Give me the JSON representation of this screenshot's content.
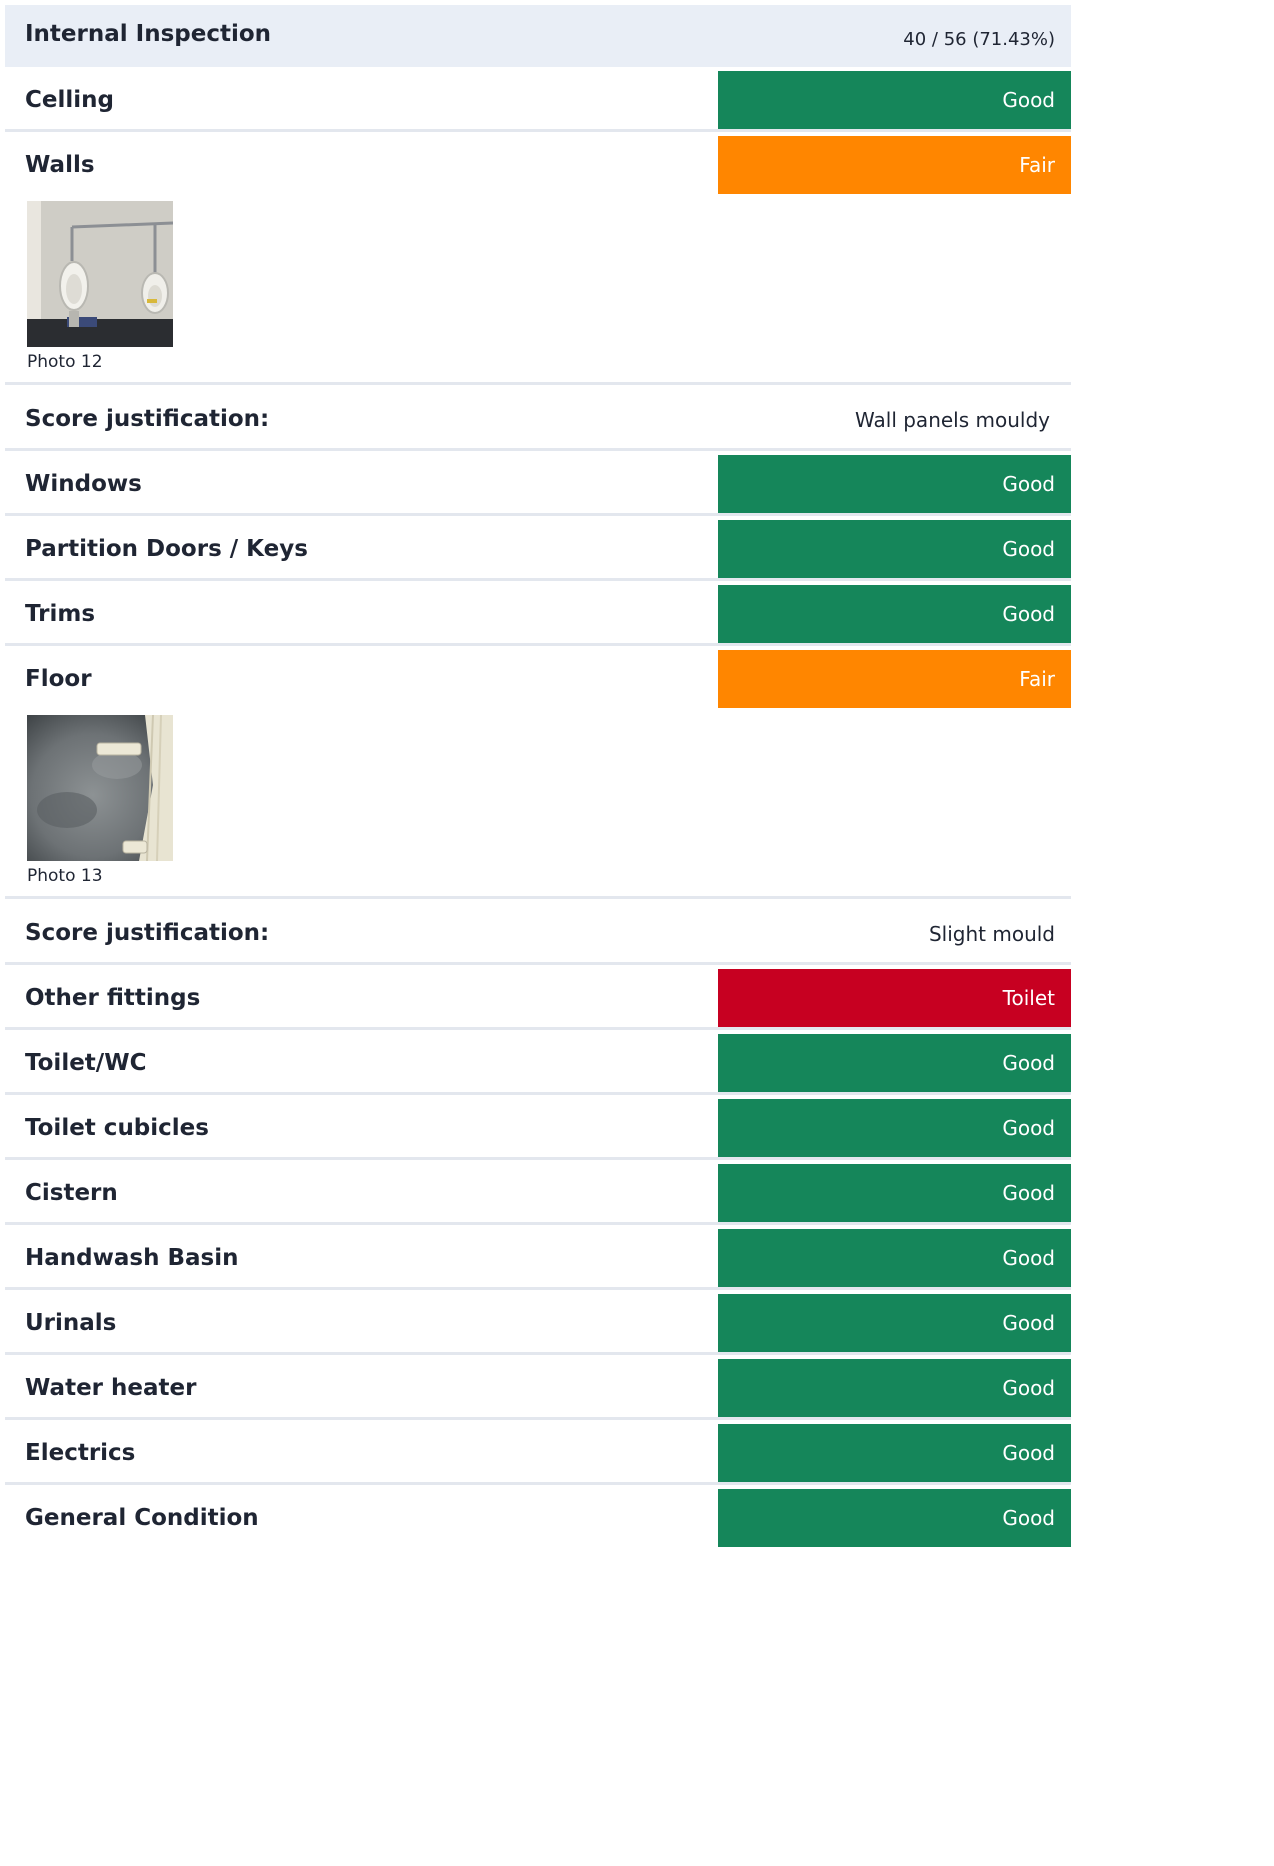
{
  "section": {
    "title": "Internal Inspection",
    "score": "40 / 56 (71.43%)"
  },
  "items": [
    {
      "label": "Celling",
      "rating": "Good",
      "status": "good"
    },
    {
      "label": "Walls",
      "rating": "Fair",
      "status": "fair",
      "photo_caption": "Photo 12",
      "photo_icon": "urinal-photo",
      "justification_label": "Score justification:",
      "justification": "Wall panels mouldy"
    },
    {
      "label": "Windows",
      "rating": "Good",
      "status": "good"
    },
    {
      "label": "Partition Doors / Keys",
      "rating": "Good",
      "status": "good"
    },
    {
      "label": "Trims",
      "rating": "Good",
      "status": "good"
    },
    {
      "label": "Floor",
      "rating": "Fair",
      "status": "fair",
      "photo_caption": "Photo 13",
      "photo_icon": "floor-photo",
      "justification_label": "Score justification:",
      "justification": "Slight mould"
    },
    {
      "label": "Other fittings",
      "rating": "Toilet",
      "status": "bad"
    },
    {
      "label": "Toilet/WC",
      "rating": "Good",
      "status": "good"
    },
    {
      "label": "Toilet cubicles",
      "rating": "Good",
      "status": "good"
    },
    {
      "label": "Cistern",
      "rating": "Good",
      "status": "good"
    },
    {
      "label": "Handwash Basin",
      "rating": "Good",
      "status": "good"
    },
    {
      "label": "Urinals",
      "rating": "Good",
      "status": "good"
    },
    {
      "label": "Water heater",
      "rating": "Good",
      "status": "good"
    },
    {
      "label": "Electrics",
      "rating": "Good",
      "status": "good"
    },
    {
      "label": "General Condition",
      "rating": "Good",
      "status": "good"
    }
  ],
  "colors": {
    "good": "#15865a",
    "fair": "#ff8600",
    "bad": "#c70021",
    "header_bg": "#e9eef6"
  }
}
